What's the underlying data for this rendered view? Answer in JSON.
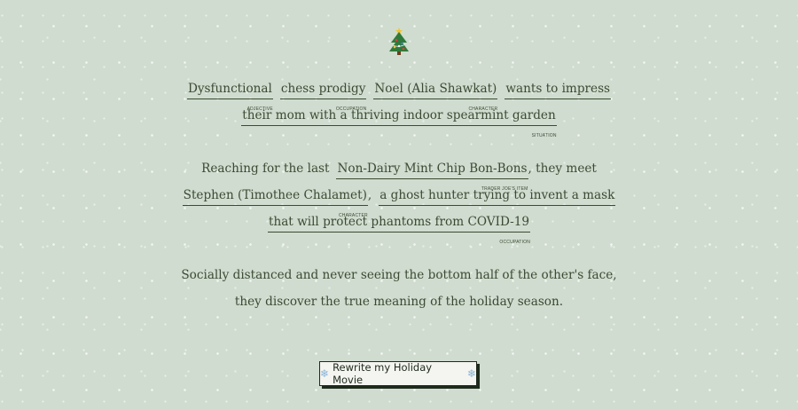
{
  "icons": {
    "tree": "christmas-tree-icon",
    "snowflake": "snowflake-icon"
  },
  "colors": {
    "background": "#cfdccf",
    "text": "#3c4a34",
    "button_bg": "#f4f4f0",
    "button_border": "#1e2a1c"
  },
  "story": {
    "p1": {
      "adjective": {
        "value": "Dysfunctional",
        "tag": "ADJECTIVE"
      },
      "occupation": {
        "value": "chess prodigy",
        "tag": "OCCUPATION"
      },
      "character": {
        "value": "Noel (Alia Shawkat)",
        "tag": "CHARACTER"
      },
      "verb": "wants to impress",
      "situation": {
        "value": "their mom with a thriving indoor spearmint garden",
        "tag": "SITUATION"
      }
    },
    "p2": {
      "intro": "Reaching for the last",
      "item": {
        "value": "Non-Dairy Mint Chip Bon-Bons",
        "tag": "TRADER JOE'S ITEM"
      },
      "they_meet": ", they meet",
      "character": {
        "value": "Stephen (Timothee Chalamet)",
        "tag": "CHARACTER"
      },
      "comma": ",",
      "occupation_part1": "a ghost hunter trying to invent a mask",
      "occupation_part2": "that will protect phantoms from COVID-19",
      "occupation_tag": "OCCUPATION"
    },
    "p3": {
      "line1": "Socially distanced and never seeing the bottom half of the other's face,",
      "line2": "they discover the true meaning of the holiday season."
    }
  },
  "button": {
    "label": "Rewrite my Holiday Movie"
  }
}
